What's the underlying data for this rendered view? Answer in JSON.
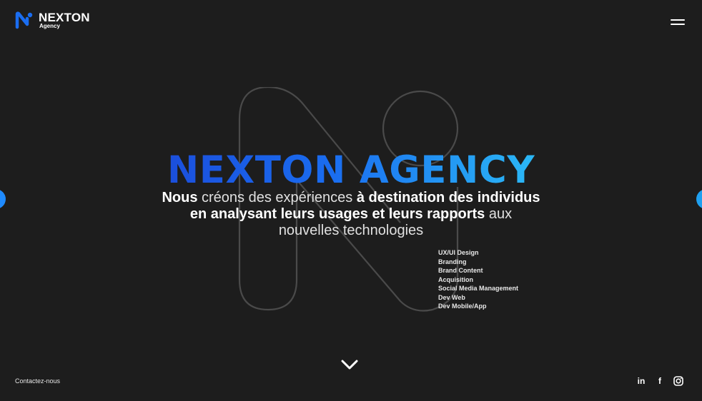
{
  "brand": {
    "name": "NEXTON",
    "sub": "Agency",
    "logo_icon": "nexton-n-logo-icon",
    "accent_color": "#1a6df0",
    "accent_color_2": "#2bb8f6"
  },
  "nav": {
    "menu_icon": "hamburger-menu-icon"
  },
  "hero": {
    "title": "NEXTON AGENCY",
    "desc": {
      "w1": "Nous",
      "w2": " créons des expériences ",
      "w3": "à destination des individus",
      "w4": "en analysant leurs usages et leurs rapports",
      "w5": " aux",
      "w6": "nouvelles technologies"
    }
  },
  "services": [
    "UX/UI Design",
    "Branding",
    "Brand Content",
    "Acquisition",
    "Social Media Management",
    "Dev Web",
    "Dev Mobile/App"
  ],
  "footer": {
    "contact_label": "Contactez-nous",
    "scroll_icon": "chevron-down-icon",
    "socials": [
      {
        "name": "linkedin-icon",
        "glyph": "in"
      },
      {
        "name": "facebook-icon",
        "glyph": "f"
      },
      {
        "name": "instagram-icon",
        "glyph": ""
      }
    ]
  }
}
